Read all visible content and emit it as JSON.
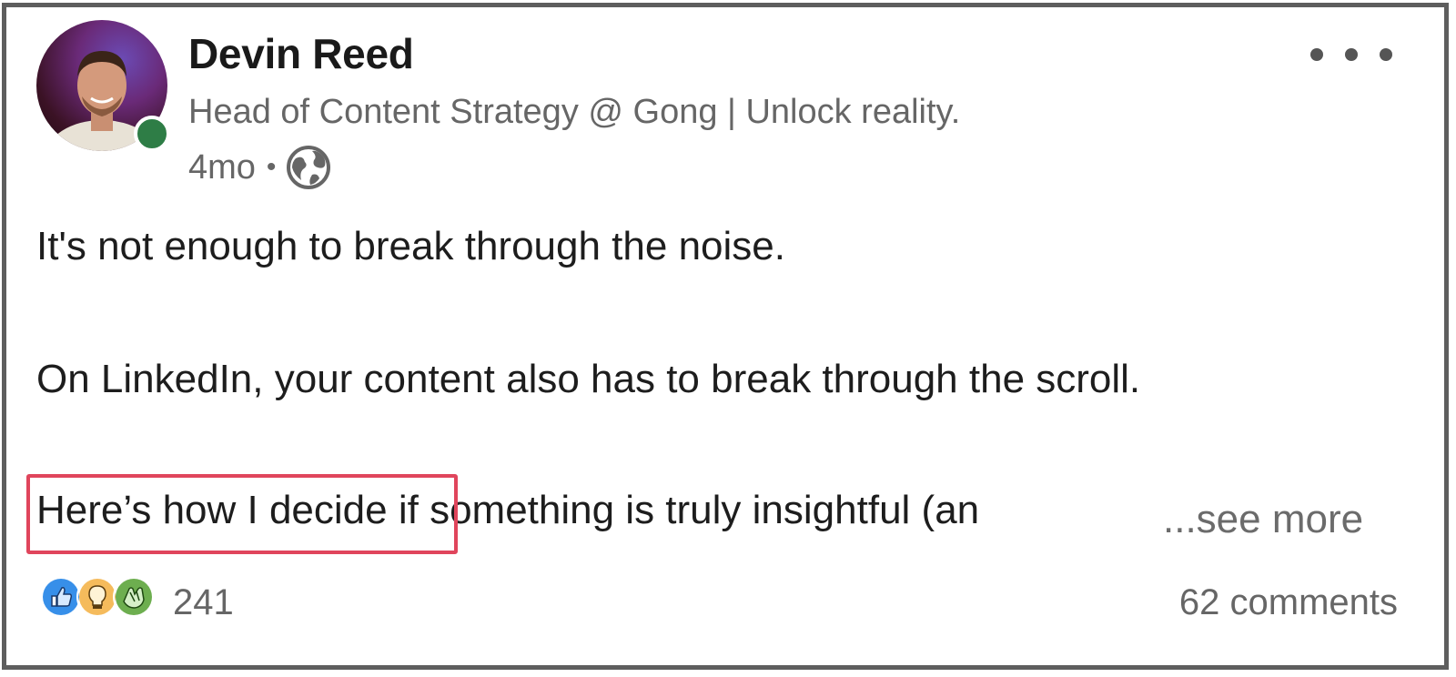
{
  "author": {
    "name": "Devin Reed",
    "headline": "Head of Content Strategy @ Gong | Unlock reality.",
    "time_ago": "4mo",
    "separator": "•",
    "visibility_icon": "globe-icon",
    "presence_icon": "online-status-dot",
    "presence_color": "#2e7d46"
  },
  "post": {
    "line1": "It's not enough to break through the noise.",
    "line2": "On LinkedIn, your content also has to break through the scroll.",
    "line3_highlighted": "Here’s how I decide",
    "line3_rest": " if something is truly insightful (an",
    "see_more": "...see more",
    "highlight_color": "#e0455c"
  },
  "social": {
    "reaction_icons": [
      "like-icon",
      "insightful-icon",
      "celebrate-icon"
    ],
    "reaction_count": "241",
    "comments": "62 comments"
  },
  "menu": {
    "icon": "more-options-icon"
  }
}
